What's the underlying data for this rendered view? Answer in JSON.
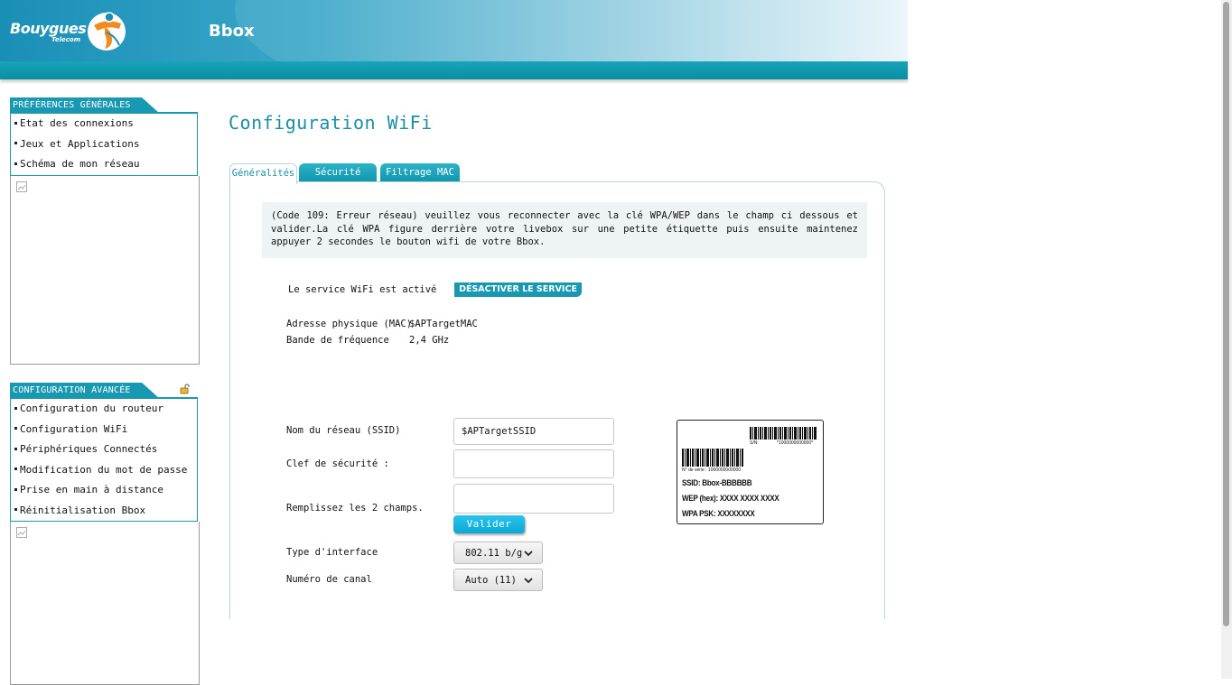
{
  "header": {
    "logo_text": "Bouygues",
    "logo_sub": "Telecom",
    "brand": "Bbox"
  },
  "sidebar": {
    "general": {
      "title": "PRÉFÉRENCES GÉNÉRALES",
      "items": [
        {
          "label": "Etat des connexions"
        },
        {
          "label": "Jeux et Applications"
        },
        {
          "label": "Schéma de mon réseau"
        }
      ]
    },
    "advanced": {
      "title": "CONFIGURATION AVANCÉE",
      "items": [
        {
          "label": "Configuration du routeur"
        },
        {
          "label": "Configuration WiFi"
        },
        {
          "label": "Périphériques Connectés"
        },
        {
          "label": "Modification du mot de passe"
        },
        {
          "label": "Prise en main à distance"
        },
        {
          "label": "Réinitialisation Bbox"
        }
      ]
    }
  },
  "main": {
    "title": "Configuration WiFi",
    "tabs": [
      {
        "label": "Généralités",
        "active": true
      },
      {
        "label": "Sécurité",
        "active": false
      },
      {
        "label": "Filtrage MAC",
        "active": false
      }
    ],
    "error_message": "(Code 109: Erreur réseau) veuillez vous reconnecter avec la clé WPA/WEP dans le champ ci dessous et valider.La clé WPA figure derrière votre livebox sur une petite étiquette puis ensuite maintenez appuyer 2 secondes le bouton wifi de votre Bbox.",
    "service_status": "Le service WiFi est activé",
    "deactivate_button": "DÉSACTIVER LE SERVICE",
    "mac_label": "Adresse physique (MAC)",
    "mac_value": "$APTargetMAC",
    "band_label": "Bande de fréquence",
    "band_value": "2,4 GHz",
    "ssid_label": "Nom du réseau (SSID)",
    "ssid_value": "$APTargetSSID",
    "key_label": "Clef de sécurité :",
    "key_value": "",
    "confirm_label": "Remplissez les 2 champs.",
    "confirm_value": "",
    "submit_label": "Valider",
    "interface_label": "Type d'interface",
    "interface_value": "802.11 b/g",
    "channel_label": "Numéro de canal",
    "channel_value": "Auto (11)",
    "sticker": {
      "sn_label": "S/N:",
      "sn_value": "*1000000000000*",
      "serie": "N° de série : 1000000000000",
      "ssid": "SSID: Bbox-BBBBBB",
      "wep": "WEP (hex): XXXX XXXX XXXX",
      "wpa": "WPA PSK: XXXXXXXX"
    }
  },
  "colors": {
    "accent": "#1899b1",
    "title": "#1a8fa5",
    "valider": "#0aa9d8"
  }
}
